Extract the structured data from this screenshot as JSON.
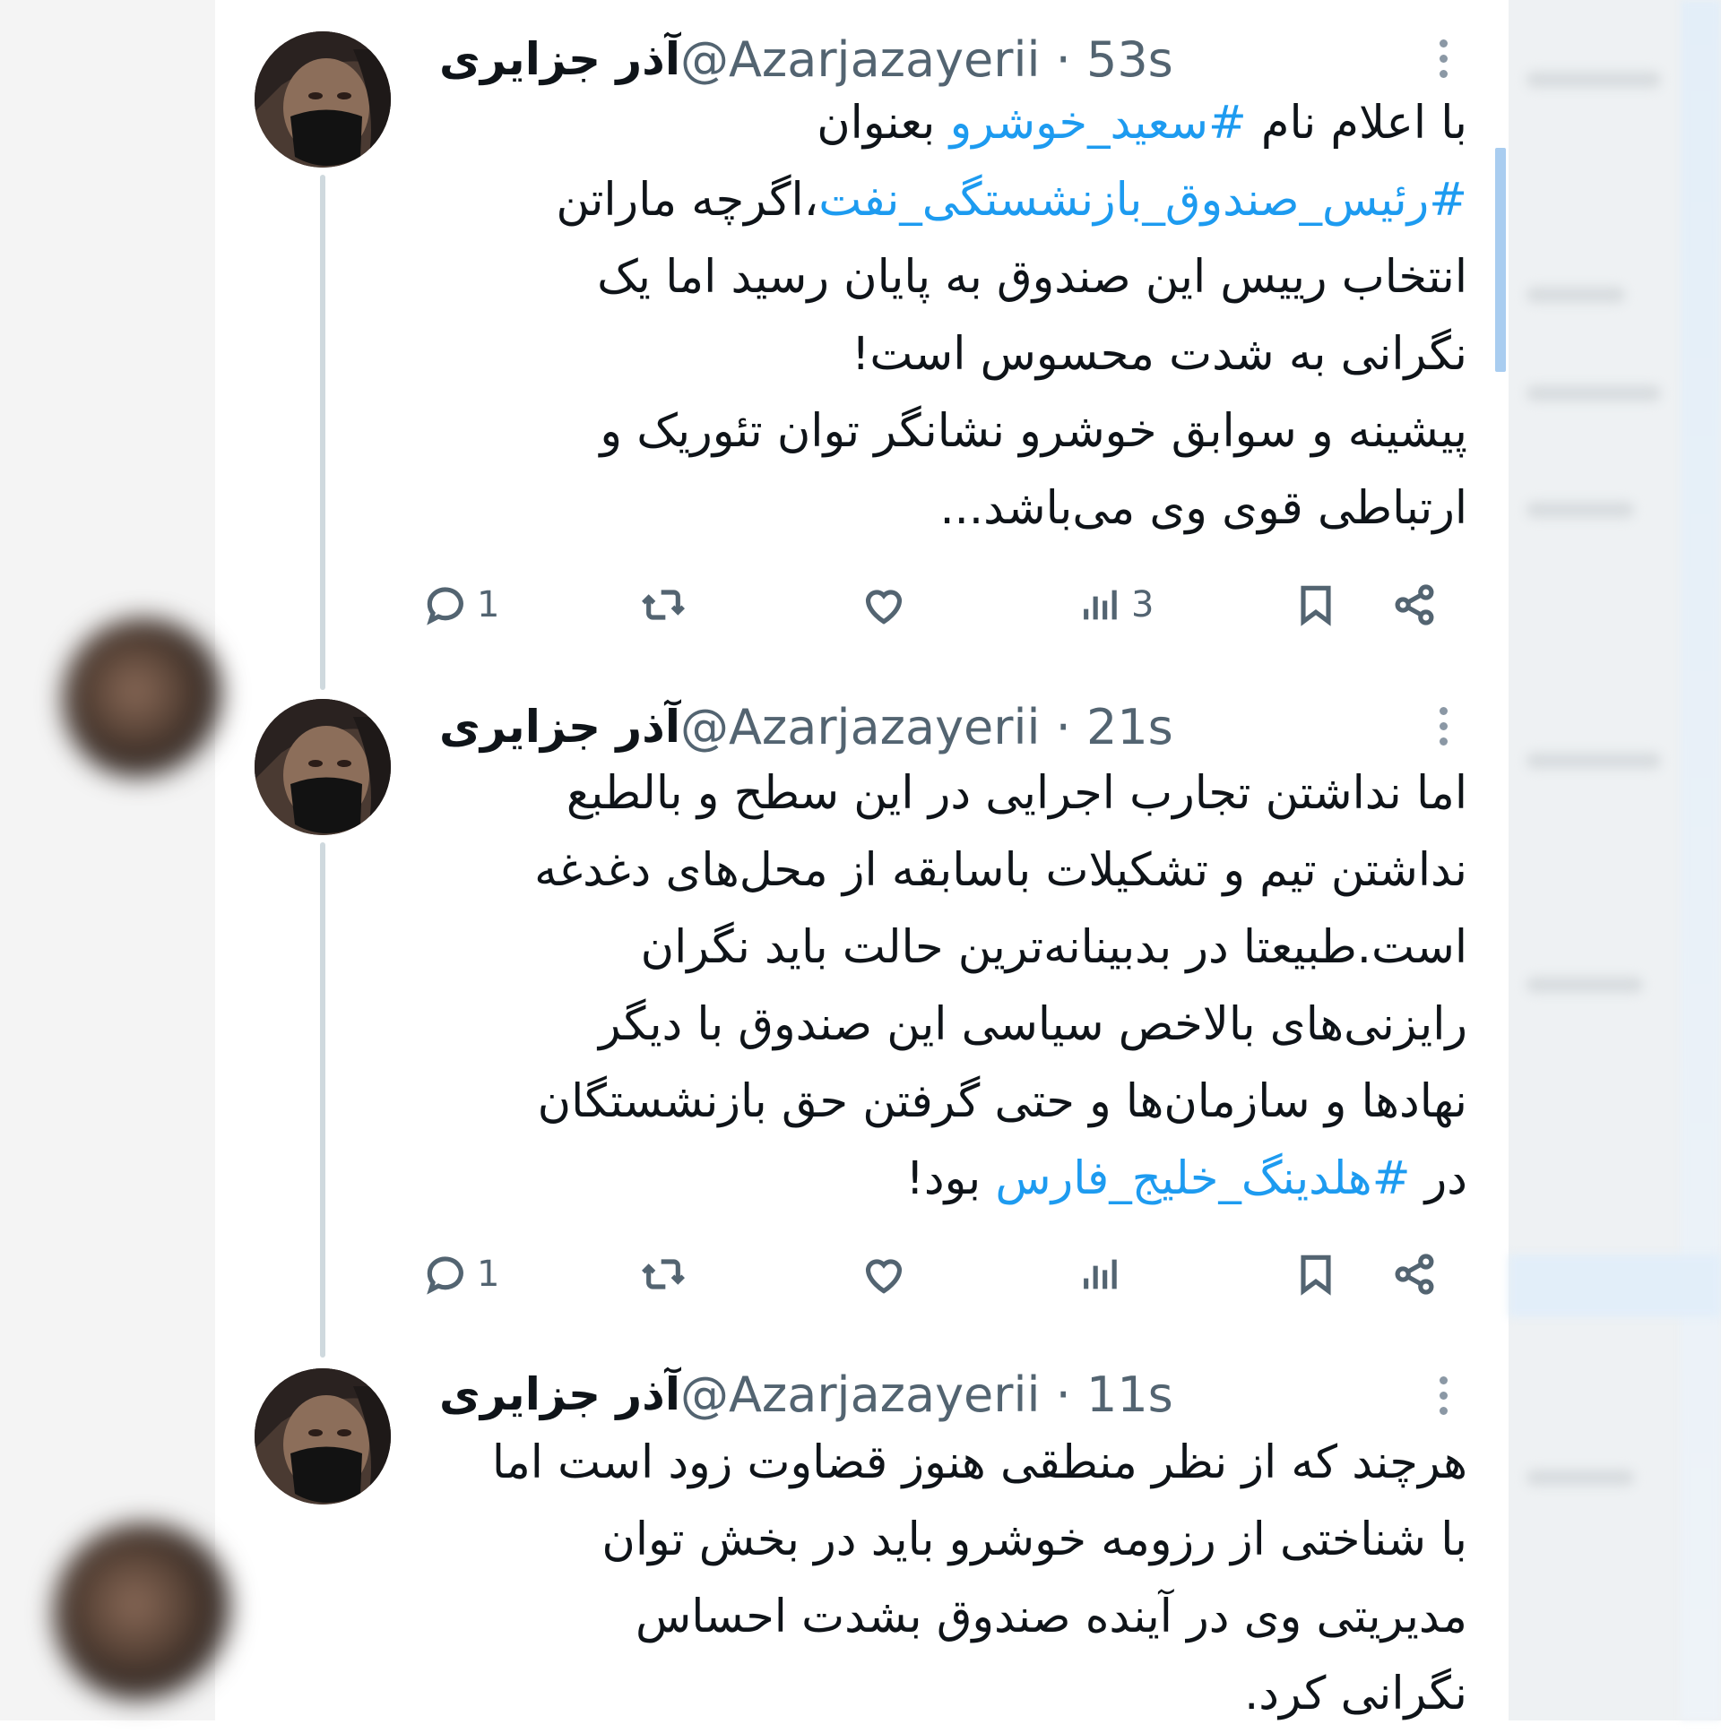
{
  "tweets": [
    {
      "name": "آذر جزایری",
      "handle_time": "@Azarjazayerii · 53s",
      "lines": [
        [
          {
            "t": "با اعلام نام "
          },
          {
            "t": "#سعید_خوشرو",
            "tag": true
          },
          {
            "t": " بعنوان"
          }
        ],
        [
          {
            "t": "#رئیس_صندوق_بازنشستگی_نفت",
            "tag": true
          },
          {
            "t": "،اگرچه ماراتن"
          }
        ],
        [
          {
            "t": "انتخاب رییس این صندوق به پایان رسید اما یک"
          }
        ],
        [
          {
            "t": "نگرانی به شدت محسوس است!"
          }
        ],
        [
          {
            "t": "پیشینه و سوابق خوشرو نشانگر توان تئوریک و"
          }
        ],
        [
          {
            "t": "ارتباطی قوی وی می‌باشد..."
          }
        ]
      ],
      "actions": {
        "reply": "1",
        "retweet": "",
        "like": "",
        "views": "3"
      }
    },
    {
      "name": "آذر جزایری",
      "handle_time": "@Azarjazayerii · 21s",
      "lines": [
        [
          {
            "t": "اما نداشتن تجارب اجرایی در این سطح و بالطبع"
          }
        ],
        [
          {
            "t": "نداشتن تیم و تشکیلات باسابقه از محل‌های دغدغه"
          }
        ],
        [
          {
            "t": "است.طبیعتا در بدبینانه‌ترین حالت باید نگران"
          }
        ],
        [
          {
            "t": "رایزنی‌های بالاخص سیاسی این صندوق با دیگر"
          }
        ],
        [
          {
            "t": "نهادها و سازمان‌ها و حتی گرفتن حق بازنشستگان"
          }
        ],
        [
          {
            "t": "در "
          },
          {
            "t": "#هلدینگ_خلیج_فارس",
            "tag": true
          },
          {
            "t": " بود!"
          }
        ]
      ],
      "actions": {
        "reply": "1",
        "retweet": "",
        "like": "",
        "views": ""
      }
    },
    {
      "name": "آذر جزایری",
      "handle_time": "@Azarjazayerii · 11s",
      "lines": [
        [
          {
            "t": "هرچند که از نظر منطقی هنوز قضاوت زود است اما"
          }
        ],
        [
          {
            "t": "با شناختی از رزومه خوشرو باید در بخش توان"
          }
        ],
        [
          {
            "t": "مدیریتی وی در آینده صندوق بشدت احساس"
          }
        ],
        [
          {
            "t": "نگرانی کرد."
          }
        ]
      ],
      "actions": null
    }
  ],
  "colors": {
    "hashtag": "#1d9bf0",
    "secondary_text": "#536471",
    "thread_line": "#cfd9de"
  },
  "icons": {
    "reply": "speech-bubble-icon",
    "retweet": "retweet-arrows-icon",
    "like": "heart-icon",
    "views": "bar-chart-icon",
    "bookmark": "bookmark-icon",
    "share": "share-icon",
    "more": "more-options-icon"
  }
}
